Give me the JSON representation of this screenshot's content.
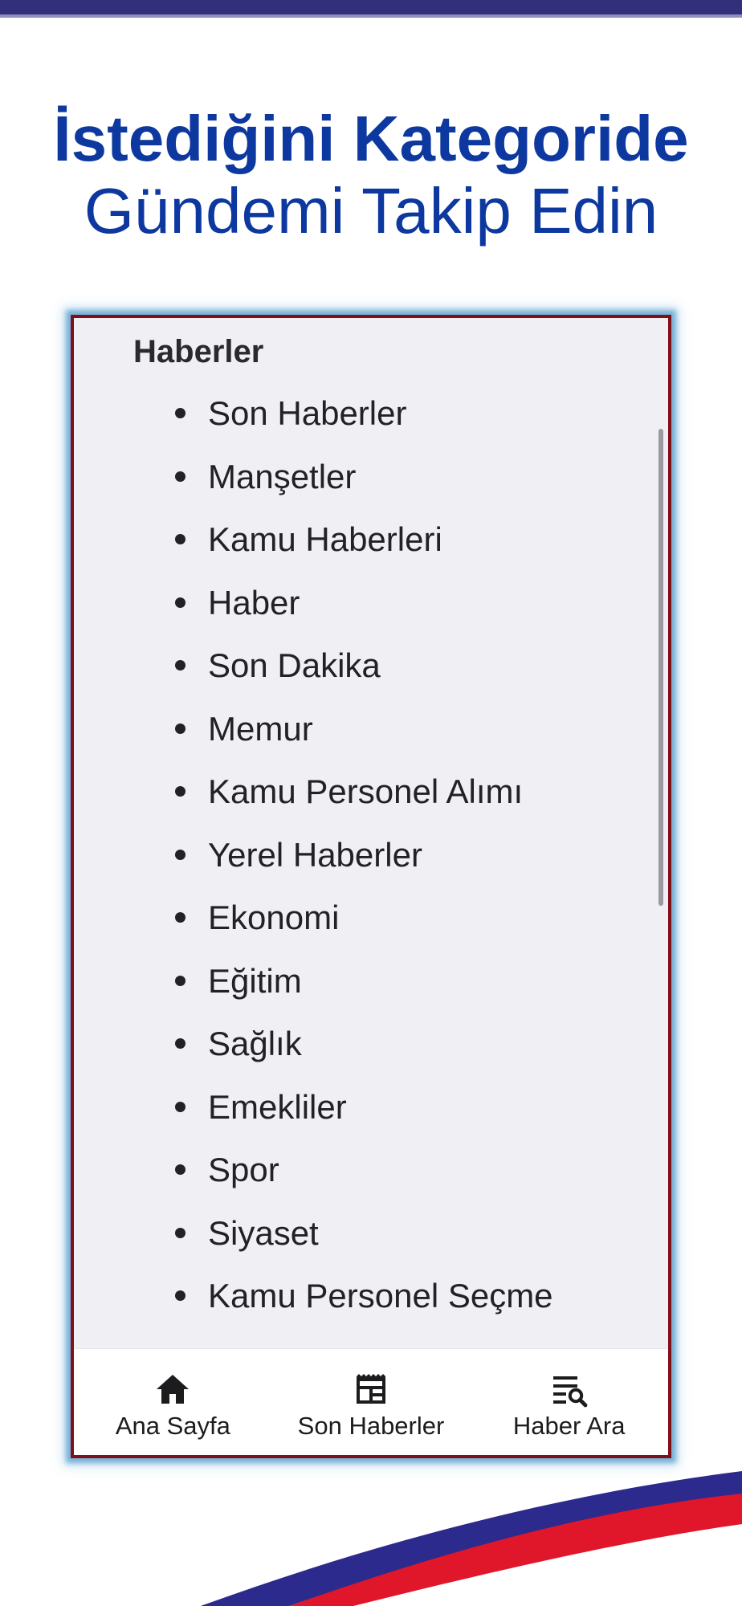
{
  "headline": {
    "line1": "İstediğini Kategoride",
    "line2": "Gündemi Takip Edin"
  },
  "section": {
    "title": "Haberler",
    "items": [
      "Son Haberler",
      "Manşetler",
      "Kamu Haberleri",
      "Haber",
      "Son Dakika",
      "Memur",
      "Kamu Personel Alımı",
      "Yerel Haberler",
      "Ekonomi",
      "Eğitim",
      "Sağlık",
      "Emekliler",
      "Spor",
      "Siyaset",
      "Kamu Personel Seçme"
    ]
  },
  "bottom_nav": [
    {
      "label": "Ana Sayfa",
      "icon": "home-icon"
    },
    {
      "label": "Son Haberler",
      "icon": "newspaper-icon"
    },
    {
      "label": "Haber Ara",
      "icon": "search-list-icon"
    }
  ],
  "colors": {
    "headline": "#0d38a0",
    "frame_border": "#7f0f18",
    "stripe_blue": "#2c2a8c",
    "stripe_red": "#e0162b"
  }
}
